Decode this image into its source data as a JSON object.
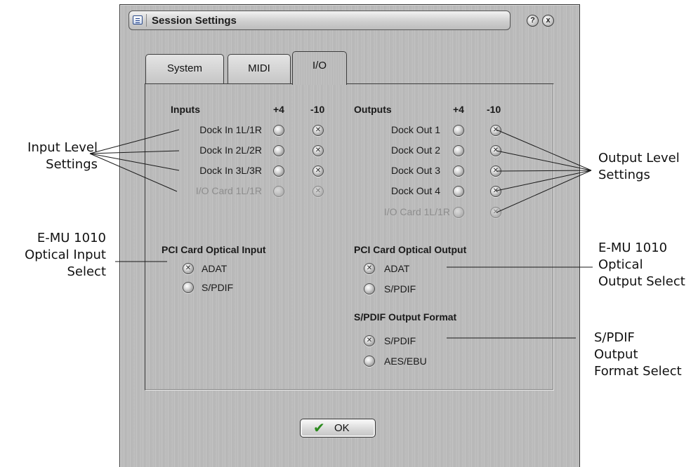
{
  "window": {
    "title": "Session Settings",
    "help_button": "?",
    "close_button": "x"
  },
  "tabs": [
    {
      "label": "System",
      "active": false
    },
    {
      "label": "MIDI",
      "active": false
    },
    {
      "label": "I/O",
      "active": true
    }
  ],
  "inputs": {
    "header": "Inputs",
    "col_plus4": "+4",
    "col_minus10": "-10",
    "rows": [
      {
        "label": "Dock In 1L/1R",
        "selected": "-10",
        "enabled": true
      },
      {
        "label": "Dock In 2L/2R",
        "selected": "-10",
        "enabled": true
      },
      {
        "label": "Dock In 3L/3R",
        "selected": "-10",
        "enabled": true
      },
      {
        "label": "I/O Card 1L/1R",
        "selected": "-10",
        "enabled": false
      }
    ]
  },
  "outputs": {
    "header": "Outputs",
    "col_plus4": "+4",
    "col_minus10": "-10",
    "rows": [
      {
        "label": "Dock Out 1",
        "selected": "-10",
        "enabled": true
      },
      {
        "label": "Dock Out 2",
        "selected": "-10",
        "enabled": true
      },
      {
        "label": "Dock Out 3",
        "selected": "-10",
        "enabled": true
      },
      {
        "label": "Dock Out 4",
        "selected": "-10",
        "enabled": true
      },
      {
        "label": "I/O Card 1L/1R",
        "selected": "-10",
        "enabled": false
      }
    ]
  },
  "pci_optical_input": {
    "header": "PCI Card Optical Input",
    "options": [
      {
        "label": "ADAT",
        "selected": true
      },
      {
        "label": "S/PDIF",
        "selected": false
      }
    ]
  },
  "pci_optical_output": {
    "header": "PCI Card Optical Output",
    "options": [
      {
        "label": "ADAT",
        "selected": true
      },
      {
        "label": "S/PDIF",
        "selected": false
      }
    ]
  },
  "spdif_output_format": {
    "header": "S/PDIF Output Format",
    "options": [
      {
        "label": "S/PDIF",
        "selected": true
      },
      {
        "label": "AES/EBU",
        "selected": false
      }
    ]
  },
  "ok_button": {
    "label": "OK"
  },
  "callouts": {
    "input_level": [
      "Input Level",
      "Settings"
    ],
    "optical_input": [
      "E-MU 1010",
      "Optical Input",
      "Select"
    ],
    "output_level": [
      "Output Level",
      "Settings"
    ],
    "optical_output": [
      "E-MU 1010",
      "Optical",
      "Output Select"
    ],
    "spdif_format": [
      "S/PDIF",
      "Output",
      "Format Select"
    ]
  }
}
